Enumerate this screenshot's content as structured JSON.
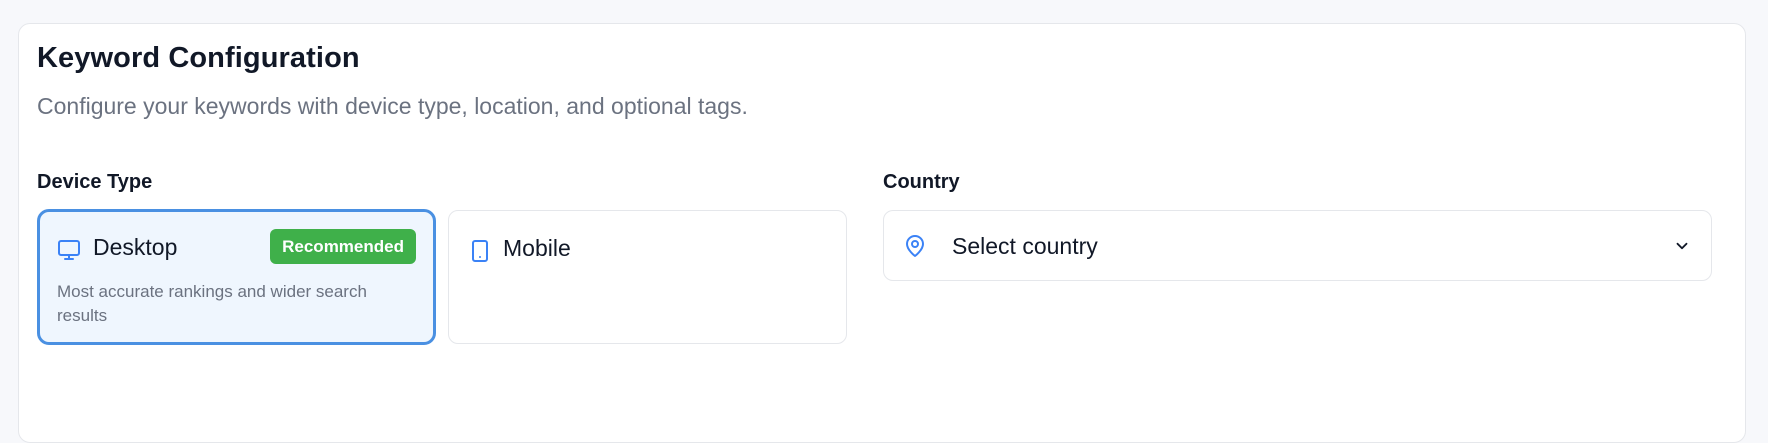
{
  "section": {
    "title": "Keyword Configuration",
    "subtitle": "Configure your keywords with device type, location, and optional tags."
  },
  "device": {
    "label": "Device Type",
    "options": [
      {
        "name": "Desktop",
        "icon": "monitor-icon",
        "badge": "Recommended",
        "description": "Most accurate rankings and wider search results",
        "selected": true
      },
      {
        "name": "Mobile",
        "icon": "smartphone-icon",
        "selected": false
      }
    ]
  },
  "country": {
    "label": "Country",
    "icon": "map-pin-icon",
    "value": "Select country"
  },
  "colors": {
    "accent": "#4a90e2",
    "selected_bg": "#eff6fe",
    "badge": "#3fb04a",
    "muted_text": "#6b7280"
  }
}
